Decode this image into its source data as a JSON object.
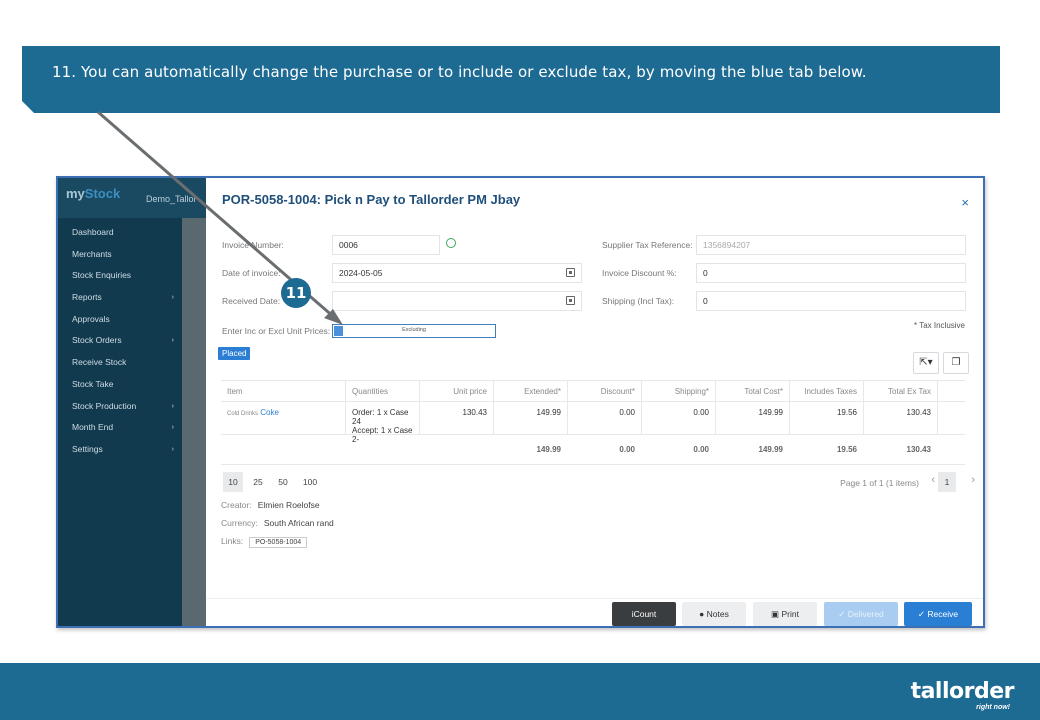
{
  "banner": {
    "text": "11. You can automatically change the purchase or to include or exclude tax, by moving the blue tab below."
  },
  "sidebar": {
    "logo_my": "my",
    "logo_stock": "Stock",
    "brand": "Demo_Tallor",
    "items": [
      {
        "label": "Dashboard",
        "caret": ""
      },
      {
        "label": "Merchants",
        "caret": ""
      },
      {
        "label": "Stock Enquiries",
        "caret": ""
      },
      {
        "label": "Reports",
        "caret": "›"
      },
      {
        "label": "Approvals",
        "caret": ""
      },
      {
        "label": "Stock Orders",
        "caret": "›"
      },
      {
        "label": "Receive Stock",
        "caret": ""
      },
      {
        "label": "Stock Take",
        "caret": ""
      },
      {
        "label": "Stock Production",
        "caret": "›"
      },
      {
        "label": "Month End",
        "caret": "›"
      },
      {
        "label": "Settings",
        "caret": "›"
      }
    ]
  },
  "panel": {
    "title": "POR-5058-1004: Pick n Pay to Tallorder PM Jbay",
    "close": "×",
    "invoice_number_label": "Invoice Number:",
    "invoice_number": "0006",
    "date_label": "Date of invoice:",
    "date": "2024-05-05",
    "received_label": "Received Date:",
    "received": "",
    "inc_excl_label": "Enter Inc or Excl Unit Prices:",
    "toggle_label": "Excluding",
    "supplier_ref_label": "Supplier Tax Reference:",
    "supplier_ref": "1356894207",
    "discount_label": "Invoice Discount %:",
    "discount": "0",
    "shipping_label": "Shipping (Incl Tax):",
    "shipping": "0",
    "tax_inclusive": "* Tax Inclusive",
    "status": "Placed"
  },
  "table": {
    "headers": [
      "Item",
      "Quantities",
      "Unit price",
      "Extended*",
      "Discount*",
      "Shipping*",
      "Total Cost*",
      "Includes Taxes",
      "Total Ex Tax"
    ],
    "item": {
      "category": "Cold Drinks",
      "name": "Coke",
      "qty_order": "Order: 1 x Case 24",
      "qty_accept": "Accept: 1 x Case 2-",
      "unit_price": "130.43",
      "extended": "149.99",
      "discount": "0.00",
      "shipping": "0.00",
      "total_cost": "149.99",
      "includes_taxes": "19.56",
      "total_ex_tax": "130.43"
    },
    "totals": {
      "extended": "149.99",
      "discount": "0.00",
      "shipping": "0.00",
      "total_cost": "149.99",
      "includes_taxes": "19.56",
      "total_ex_tax": "130.43"
    }
  },
  "pagination": {
    "sizes": [
      "10",
      "25",
      "50",
      "100"
    ],
    "info": "Page 1 of 1 (1 items)",
    "prev": "‹",
    "next": "›",
    "page": "1"
  },
  "meta": {
    "creator_label": "Creator:",
    "creator": "Elmien Roelofse",
    "currency_label": "Currency:",
    "currency": "South African rand",
    "links_label": "Links:",
    "link": "PO-5058-1004"
  },
  "buttons": {
    "icount": "iCount",
    "notes": "Notes",
    "print": "Print",
    "delivered": "Delivered",
    "receive": "Receive"
  },
  "callout": {
    "number": "11"
  },
  "footer": {
    "logo": "tallorder",
    "tagline": "right now!"
  },
  "colors": {
    "banner": "#1d6a93",
    "sidebar": "#123a4f",
    "accent": "#2a7fd4"
  }
}
